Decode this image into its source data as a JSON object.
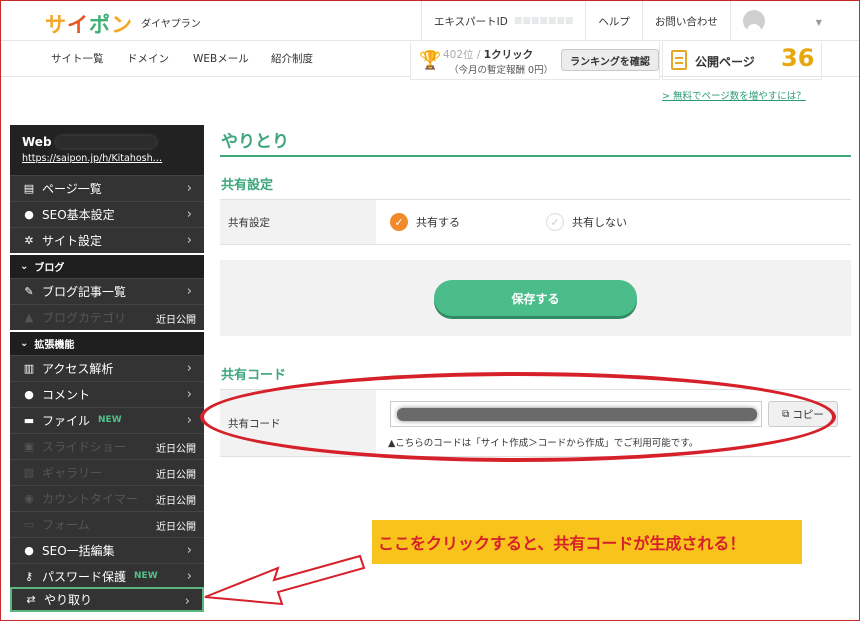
{
  "header": {
    "logo": [
      "サ",
      "イ",
      "ポ",
      "ン"
    ],
    "logo_colors": [
      "#f5a623",
      "#e8541f",
      "#3db274",
      "#f5a623"
    ],
    "plan": "ダイヤプラン",
    "expert_id_label": "エキスパートID",
    "help": "ヘルプ",
    "contact": "お問い合わせ"
  },
  "subnav": {
    "sites": "サイト一覧",
    "domain": "ドメイン",
    "webmail": "WEBメール",
    "referral": "紹介制度"
  },
  "ranking": {
    "rank_prefix": "40",
    "rank_suffix": "2位 / ",
    "clicks": "1クリック",
    "sub": "（今月の暫定報酬 0円）",
    "button": "ランキングを確認"
  },
  "public_pages": {
    "label": "公開ページ",
    "count": "36"
  },
  "free_link": "> 無料でページ数を増やすには？",
  "sidebar": {
    "site_prefix": "Web",
    "site_url": "https://saipon.jp/h/Kitahosh…",
    "items_top": [
      {
        "label": "ページ一覧",
        "icon": "document-icon"
      },
      {
        "label": "SEO基本設定",
        "icon": "globe-icon"
      },
      {
        "label": "サイト設定",
        "icon": "gear-icon"
      }
    ],
    "blog_head": "ブログ",
    "blog_items": [
      {
        "label": "ブログ記事一覧"
      },
      {
        "label": "ブログカテゴリ",
        "recent": "近日公開"
      }
    ],
    "ext_head": "拡張機能",
    "ext_items": [
      {
        "label": "アクセス解析"
      },
      {
        "label": "コメント"
      },
      {
        "label": "ファイル",
        "badge": "NEW"
      },
      {
        "label": "スライドショー",
        "recent": "近日公開"
      },
      {
        "label": "ギャラリー",
        "recent": "近日公開"
      },
      {
        "label": "カウントタイマー",
        "recent": "近日公開"
      },
      {
        "label": "フォーム",
        "recent": "近日公開"
      },
      {
        "label": "SEO一括編集"
      },
      {
        "label": "パスワード保護",
        "badge": "NEW"
      },
      {
        "label": "やり取り"
      }
    ]
  },
  "main": {
    "title": "やりとり",
    "share_settings_title": "共有設定",
    "share_label": "共有設定",
    "share_on": "共有する",
    "share_off": "共有しない",
    "save": "保存する",
    "code_title": "共有コード",
    "code_label": "共有コード",
    "copy": "コピー",
    "note": "▲こちらのコードは「サイト作成＞コードから作成」でご利用可能です。"
  },
  "annotation": "ここをクリックすると、共有コードが生成される！"
}
